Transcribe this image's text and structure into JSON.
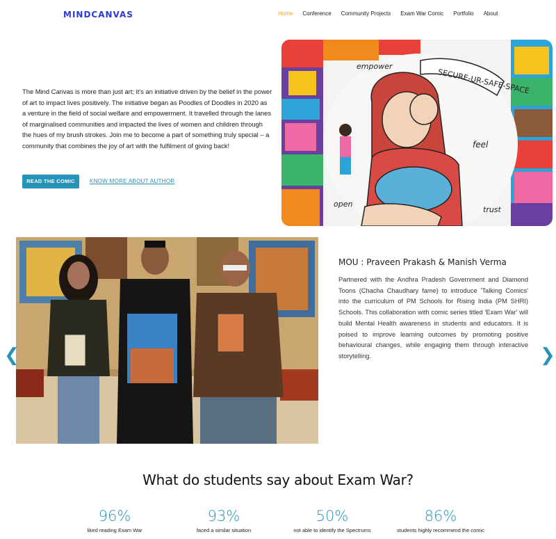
{
  "nav": {
    "logo": "MINDCANVAS",
    "items": [
      {
        "label": "Home",
        "active": true
      },
      {
        "label": "Conference",
        "active": false
      },
      {
        "label": "Community Projects",
        "active": false
      },
      {
        "label": "Exam War Comic",
        "active": false
      },
      {
        "label": "Portfolio",
        "active": false
      },
      {
        "label": "About",
        "active": false
      }
    ]
  },
  "intro": {
    "text": "The Mind Canvas is more than just art; it's an initiative driven by the belief in the power of art to impact lives positively. The initiative began as Poodles of Doodles in 2020 as a venture in the field of social welfare and empowerment. It travelled through the lanes of marginalised communities and impacted the lives of women and children through the hues of my brush strokes.  Join me to become a part of something truly special – a community that combines the joy of art with the fulfilment of giving back!",
    "read_button": "READ THE COMIC",
    "author_link": "KNOW MORE ABOUT AUTHOR"
  },
  "artwork": {
    "words": [
      "empower",
      "SECURE-UR-SAFE-SPACE",
      "feel",
      "open",
      "trust"
    ]
  },
  "mou": {
    "title": "MOU : Praveen Prakash & Manish Verma",
    "body": "Partnered with the Andhra Pradesh Government and Diamond Toons (Chacha Chaudhary fame) to introduce 'Talking Comics' into the curriculum of PM Schools for Rising India (PM SHRI) Schools. This collaboration with comic series titled 'Exam War' will build Mental Health awareness in students and educators. It is poised to improve learning outcomes by promoting positive behavioural changes, while engaging them through interactive storytelling.",
    "prev": "❮",
    "next": "❯"
  },
  "stats": {
    "title": "What do students say about Exam War?",
    "items": [
      {
        "value": "96%",
        "label": "liked reading Exam War"
      },
      {
        "value": "93%",
        "label": "faced a similar situation"
      },
      {
        "value": "50%",
        "label": "not able to identify the Spectrums"
      },
      {
        "value": "86%",
        "label": "students highly recommend the comic"
      }
    ]
  },
  "colors": {
    "accent": "#2594b8",
    "nav_active": "#f2a71b",
    "logo": "#2a3bd6"
  }
}
